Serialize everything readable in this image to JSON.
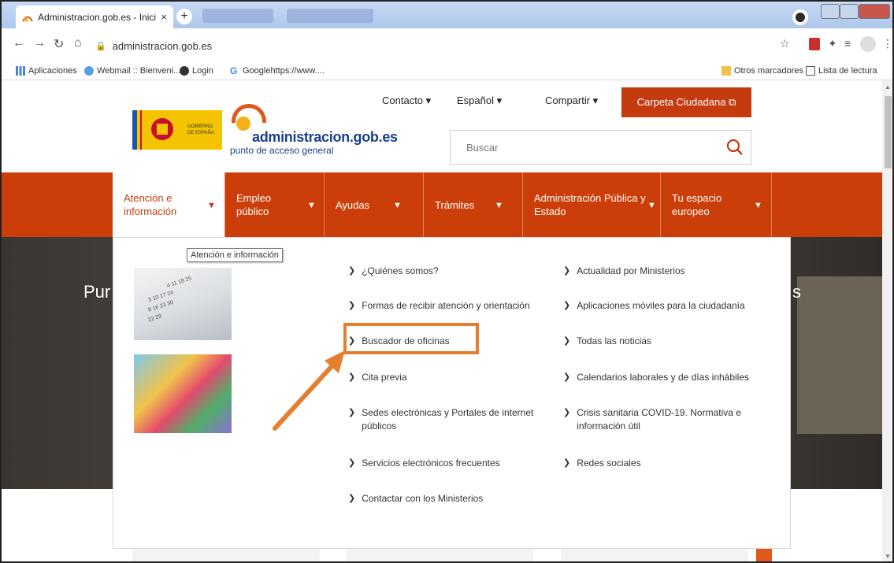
{
  "browser": {
    "tab_title": "Administracion.gob.es - Inicio",
    "tab_close": "×",
    "new_tab": "+",
    "url": "administracion.gob.es",
    "bookmarks": [
      {
        "label": "Aplicaciones",
        "icon": "apps-grid-icon"
      },
      {
        "label": "Webmail :: Bienveni...",
        "icon": "webmail-icon"
      },
      {
        "label": "Login",
        "icon": "login-icon"
      },
      {
        "label": "Googlehttps://www....",
        "icon": "google-icon"
      }
    ],
    "other_bookmarks": "Otros marcadores",
    "reading_list": "Lista de lectura"
  },
  "header": {
    "contacto": "Contacto ▾",
    "espanol": "Español ▾",
    "compartir": "Compartir ▾",
    "carpeta": "Carpeta Ciudadana ⧉",
    "gov_label": "GOBIERNO DE ESPAÑA",
    "site_name": "administracion.gob.es",
    "site_tagline": "punto de acceso general",
    "search_placeholder": "Buscar"
  },
  "nav": {
    "items": [
      {
        "label1": "Atención e",
        "label2": "información"
      },
      {
        "label1": "Empleo",
        "label2": "público"
      },
      {
        "label1": "Ayudas",
        "label2": ""
      },
      {
        "label1": "Trámites",
        "label2": ""
      },
      {
        "label1": "Administración Pública y",
        "label2": "Estado"
      },
      {
        "label1": "Tu espacio",
        "label2": "europeo"
      }
    ],
    "chevron": "⌄"
  },
  "hero": {
    "left_text": "Pur",
    "right_text": "s"
  },
  "dropdown": {
    "tooltip": "Atención e información",
    "col1": [
      {
        "label": "¿Quiénes somos?"
      },
      {
        "label": "Formas de recibir atención y orientación"
      },
      {
        "label": "Buscador de oficinas"
      },
      {
        "label": "Cita previa"
      },
      {
        "label": "Sedes electrónicas y Portales de internet públicos"
      },
      {
        "label": "Servicios electrónicos frecuentes"
      },
      {
        "label": "Contactar con los Ministerios"
      }
    ],
    "col2": [
      {
        "label": "Actualidad por Ministerios"
      },
      {
        "label": "Aplicaciones móviles para la ciudadanía"
      },
      {
        "label": "Todas las noticias"
      },
      {
        "label": "Calendarios laborales y de días inhábiles"
      },
      {
        "label": "Crisis sanitaria COVID-19. Normativa e información útil"
      },
      {
        "label": "Redes sociales"
      }
    ],
    "arrow_glyph": "›"
  },
  "colors": {
    "nav_bg": "#cc3e09",
    "accent": "#c43b10",
    "annotation": "#e67e30",
    "logo_blue": "#1b3f8b"
  }
}
